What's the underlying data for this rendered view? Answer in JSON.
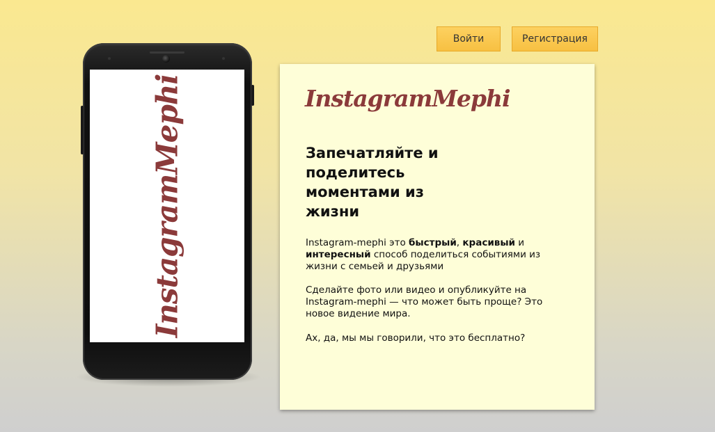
{
  "header": {
    "login_label": "Войти",
    "register_label": "Регистрация"
  },
  "phone": {
    "screen_logo": "InstagramMephi"
  },
  "card": {
    "logo": "InstagramMephi",
    "heading": "Запечатляйте и поделитесь моментами из жизни",
    "paragraph1": {
      "t1": "Instagram-mephi это ",
      "b1": "быстрый",
      "t2": ", ",
      "b2": "красивый",
      "t3": " и ",
      "b3": "интересный",
      "t4": " способ поделиться событиями из жизни с семьей и друзьями"
    },
    "paragraph2": "Сделайте фото или видео и опубликуйте на Instagram-mephi — что может быть проще? Это новое видение мира.",
    "paragraph3": "Ах, да, мы мы говорили, что это бесплатно?"
  },
  "colors": {
    "accent": "#f7c042",
    "brand": "#8b3a3a",
    "card_bg": "#fefed8"
  }
}
